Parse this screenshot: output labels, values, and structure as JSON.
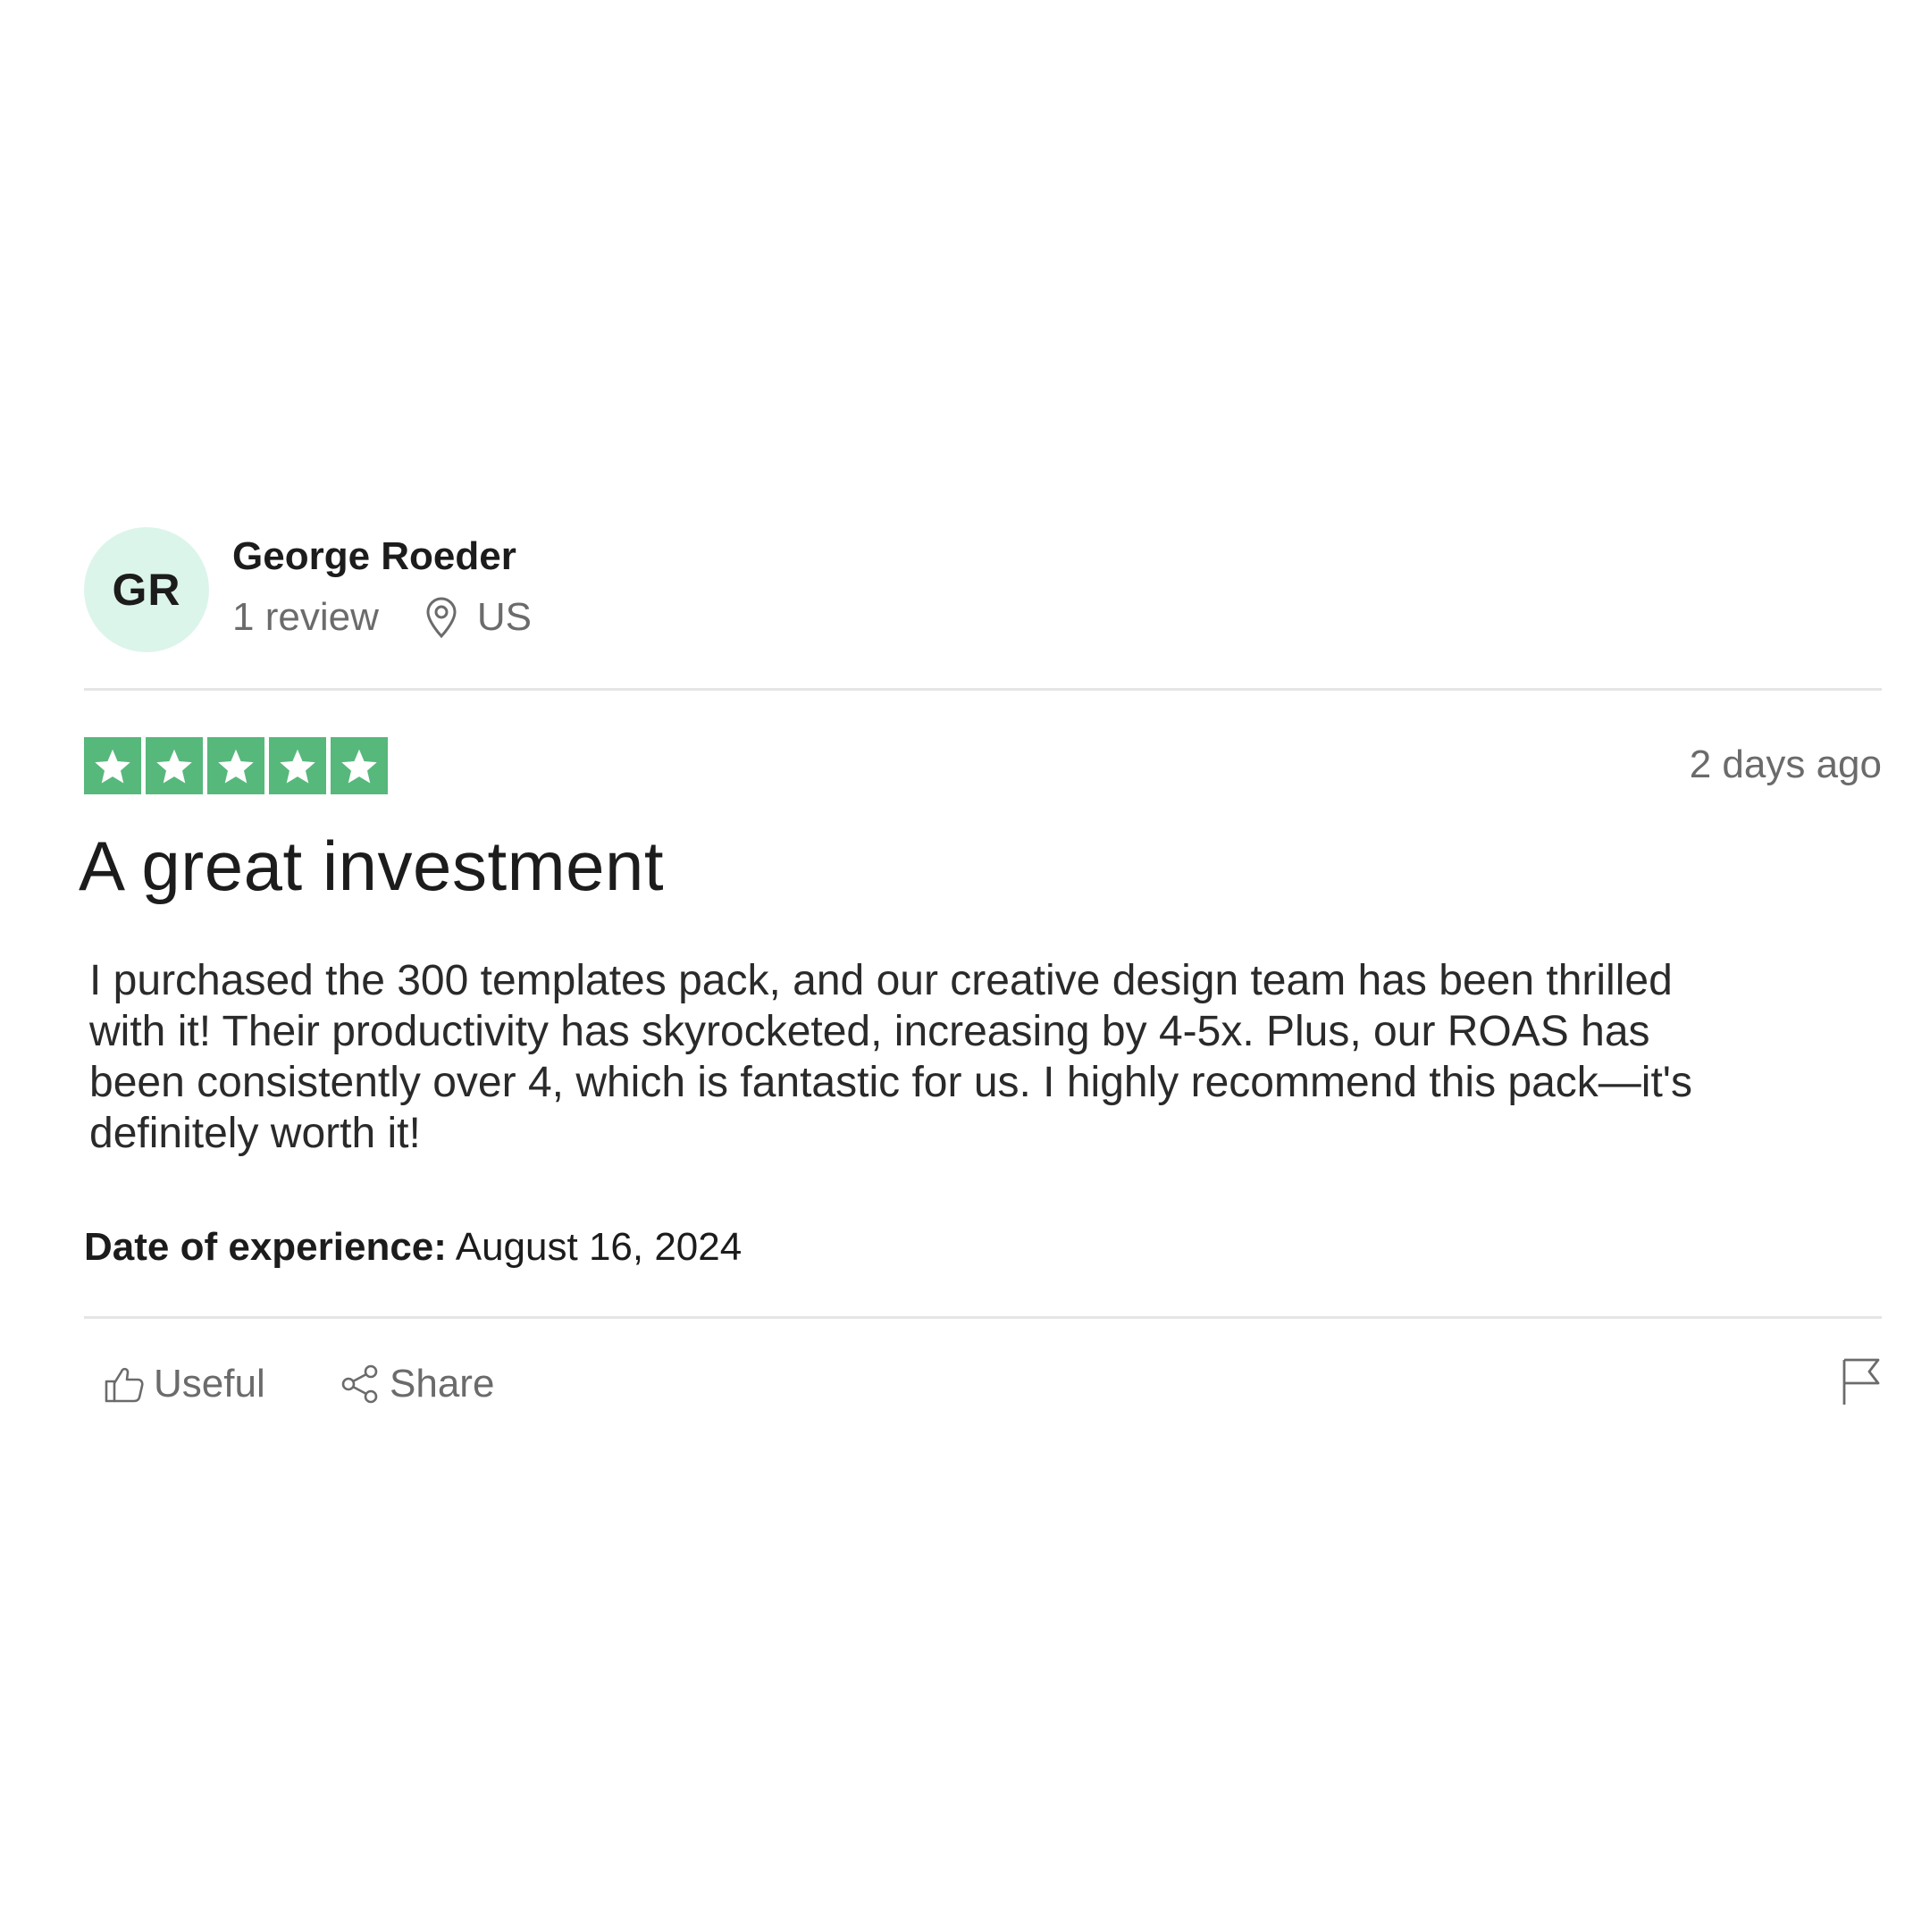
{
  "reviewer": {
    "initials": "GR",
    "name": "George Roeder",
    "review_count": "1 review",
    "country": "US",
    "avatar_color": "#dcf5ea"
  },
  "review": {
    "rating": 5,
    "rating_max": 5,
    "star_color": "#57b87c",
    "posted": "2 days ago",
    "title": "A great investment",
    "body_lines": [
      "I purchased the 300 templates pack, and our creative design team has been thrilled",
      "with it! Their productivity has skyrocketed, increasing by 4-5x. Plus, our ROAS has",
      "been consistently over 4, which is fantastic for us. I highly recommend this pack—it's",
      "definitely worth it!"
    ],
    "experience_label": "Date of experience:",
    "experience_date": "August 16, 2024"
  },
  "actions": {
    "useful_label": "Useful",
    "share_label": "Share",
    "useful_icon": "thumbs-up-icon",
    "share_icon": "share-icon",
    "report_icon": "flag-icon"
  }
}
